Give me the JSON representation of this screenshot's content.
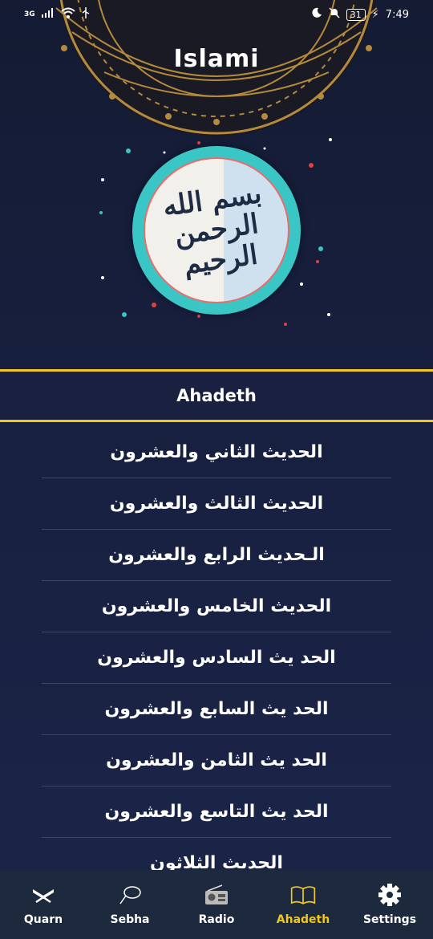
{
  "status_bar": {
    "network": "3G",
    "battery_level": "31",
    "time": "7:49"
  },
  "app": {
    "title": "Islami"
  },
  "emblem": {
    "calligraphy": "بسم الله الرحمن الرحيم"
  },
  "section": {
    "title": "Ahadeth"
  },
  "hadith_items": [
    {
      "label": "الحديث الثاني والعشرون"
    },
    {
      "label": "الحديث الثالث والعشرون"
    },
    {
      "label": "الـحديث الرابع والعشرون"
    },
    {
      "label": "الحديث الخامس والعشرون"
    },
    {
      "label": "الحد يث السادس والعشرون"
    },
    {
      "label": "الحد يث السابع والعشرون"
    },
    {
      "label": "الحد يث الثامن والعشرون"
    },
    {
      "label": "الحد يث التاسع والعشرون"
    },
    {
      "label": "الحديث الثلاثون"
    }
  ],
  "bottom_nav": {
    "items": [
      {
        "label": "Quarn",
        "icon": "quran-stand-icon"
      },
      {
        "label": "Sebha",
        "icon": "sebha-icon"
      },
      {
        "label": "Radio",
        "icon": "radio-icon"
      },
      {
        "label": "Ahadeth",
        "icon": "book-icon"
      },
      {
        "label": "Settings",
        "icon": "gear-icon"
      }
    ],
    "active_index": 3
  },
  "colors": {
    "accent_gold": "#f2c81c",
    "background": "#182040",
    "nav_background": "#1d2a3d",
    "emblem_teal": "#3bc6c6"
  }
}
